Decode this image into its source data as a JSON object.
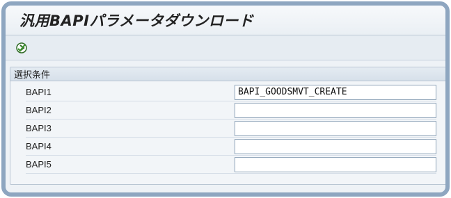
{
  "window": {
    "title": "汎用BAPIパラメータダウンロード"
  },
  "toolbar": {
    "execute_icon": "execute-icon"
  },
  "selection": {
    "group_title": "選択条件",
    "fields": [
      {
        "label": "BAPI1",
        "value": "BAPI_GOODSMVT_CREATE"
      },
      {
        "label": "BAPI2",
        "value": ""
      },
      {
        "label": "BAPI3",
        "value": ""
      },
      {
        "label": "BAPI4",
        "value": ""
      },
      {
        "label": "BAPI5",
        "value": ""
      }
    ]
  },
  "colors": {
    "frame": "#8ea6c0",
    "background": "#eef2f6",
    "execute_icon": "#3a8f2c"
  }
}
